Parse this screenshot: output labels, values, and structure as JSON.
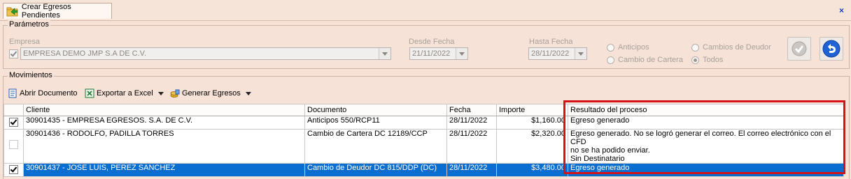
{
  "window": {
    "tab_title": "Crear Egresos Pendientes",
    "close_glyph": "×"
  },
  "parametros": {
    "title": "Parámetros",
    "empresa_label": "Empresa",
    "empresa_value": "EMPRESA DEMO JMP S.A DE C.V.",
    "desde_label": "Desde Fecha",
    "desde_value": "21/11/2022",
    "hasta_label": "Hasta Fecha",
    "hasta_value": "28/11/2022",
    "radios": {
      "anticipos": "Anticipos",
      "cambio_cartera": "Cambio de Cartera",
      "cambios_deudor": "Cambios de Deudor",
      "todos": "Todos",
      "selected": "todos"
    }
  },
  "movimientos": {
    "title": "Movimientos",
    "toolbar": {
      "abrir": "Abrir Documento",
      "exportar": "Exportar a Excel",
      "generar": "Generar Egresos"
    },
    "columns": {
      "cliente": "Cliente",
      "documento": "Documento",
      "fecha": "Fecha",
      "importe": "Importe",
      "resultado": "Resultado del proceso"
    },
    "rows": [
      {
        "checked": true,
        "cliente": "30901435 - EMPRESA EGRESOS. S.A. DE C.V.",
        "documento": "Anticipos 550/RCP11",
        "fecha": "28/11/2022",
        "importe": "$1,160.00",
        "resultado": "Egreso generado"
      },
      {
        "checked": false,
        "cliente": "30901436 - RODOLFO, PADILLA TORRES",
        "documento": "Cambio de Cartera DC 12189/CCP",
        "fecha": "28/11/2022",
        "importe": "$2,320.00",
        "resultado_1": "Egreso generado. No se logró generar el correo. El correo electrónico con el CFD",
        "resultado_2": "no se ha podido enviar.",
        "resultado_3": "Sin Destinatario"
      },
      {
        "checked": true,
        "cliente": "30901437 - JOSE LUIS, PEREZ SANCHEZ",
        "documento": "Cambio de Deudor DC 815/DDP (DC)",
        "fecha": "28/11/2022",
        "importe": "$3,480.00",
        "resultado": "Egreso generado"
      }
    ]
  },
  "colors": {
    "selected_row": "#0a6ed1",
    "highlight_border": "#d5111a"
  }
}
